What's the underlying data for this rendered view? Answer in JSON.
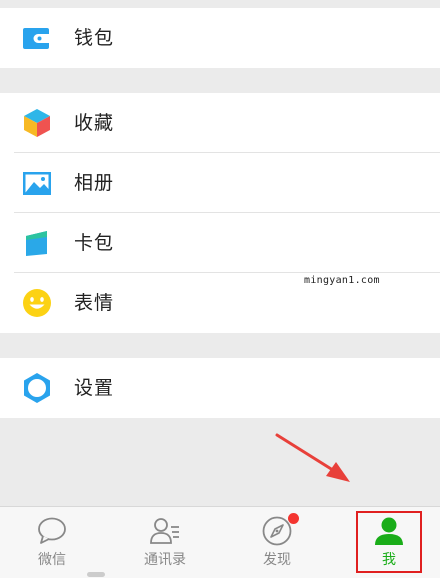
{
  "menu": {
    "wallet": "钱包",
    "favorites": "收藏",
    "album": "相册",
    "cards": "卡包",
    "stickers": "表情",
    "settings": "设置"
  },
  "watermark": "mingyan1.com",
  "tabbar": {
    "chats": "微信",
    "contacts": "通讯录",
    "discover": "发现",
    "me": "我"
  },
  "colors": {
    "accent": "#1aad19",
    "icon_blue": "#29a3ed",
    "badge_red": "#f43530",
    "highlight_red": "#e02020",
    "arrow_red": "#e8403a"
  },
  "icons": {
    "wallet": "wallet-icon",
    "favorites": "cube-icon",
    "album": "picture-icon",
    "cards": "card-icon",
    "stickers": "smiley-icon",
    "settings": "gear-icon"
  }
}
